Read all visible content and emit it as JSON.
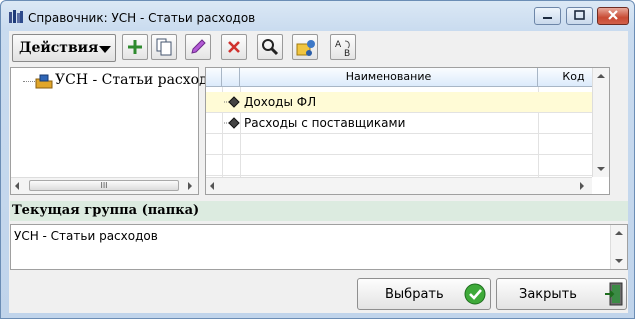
{
  "window": {
    "title": "Справочник: УСН - Статьи расходов"
  },
  "toolbar": {
    "actions_label": "Действия",
    "buttons": [
      "add-icon",
      "copy-icon",
      "edit-icon",
      "delete-icon",
      "search-icon",
      "hierarchy-icon",
      "sort-az-icon"
    ]
  },
  "tree": {
    "root_label": "УСН - Статьи расходов",
    "scroll_thumb": "III"
  },
  "grid": {
    "columns": [
      "Наименование",
      "Код"
    ],
    "rows": [
      {
        "name": "Доходы ФЛ",
        "code": ""
      },
      {
        "name": "Расходы с поставщиками",
        "code": ""
      }
    ]
  },
  "group": {
    "label": "Текущая группа (папка)",
    "value": "УСН - Статьи расходов"
  },
  "footer": {
    "select_label": "Выбрать",
    "close_label": "Закрыть"
  },
  "colors": {
    "accent_green": "#2e8b2e",
    "delete_red": "#d0312d",
    "selected_row": "#fffbd6",
    "group_bar": "#dcebe0"
  }
}
